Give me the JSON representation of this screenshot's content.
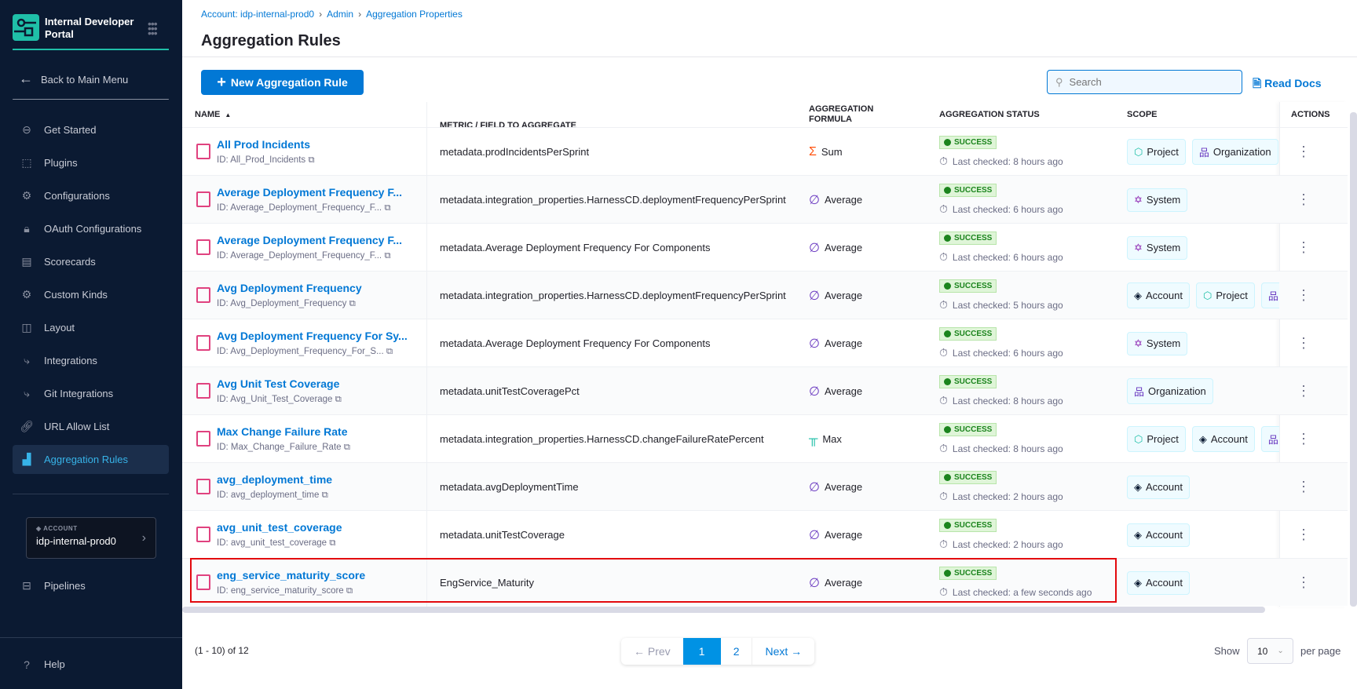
{
  "sidebar": {
    "brand": "Internal Developer Portal",
    "back": "Back to Main Menu",
    "items": [
      {
        "label": "Get Started",
        "icon": "get-started-icon"
      },
      {
        "label": "Plugins",
        "icon": "plugins-icon"
      },
      {
        "label": "Configurations",
        "icon": "gears-icon"
      },
      {
        "label": "OAuth Configurations",
        "icon": "lock-icon"
      },
      {
        "label": "Scorecards",
        "icon": "scorecard-icon"
      },
      {
        "label": "Custom Kinds",
        "icon": "gear-icon"
      },
      {
        "label": "Layout",
        "icon": "layout-icon"
      },
      {
        "label": "Integrations",
        "icon": "integrations-icon"
      },
      {
        "label": "Git Integrations",
        "icon": "git-icon"
      },
      {
        "label": "URL Allow List",
        "icon": "link-icon"
      },
      {
        "label": "Aggregation Rules",
        "icon": "aggregation-icon",
        "active": true
      }
    ],
    "account": {
      "label": "ACCOUNT",
      "value": "idp-internal-prod0"
    },
    "pipelines": "Pipelines",
    "help": "Help"
  },
  "breadcrumb": [
    "Account: idp-internal-prod0",
    "Admin",
    "Aggregation Properties"
  ],
  "page_title": "Aggregation Rules",
  "toolbar": {
    "new_label": "New Aggregation Rule",
    "search_placeholder": "Search",
    "docs_label": "Read Docs"
  },
  "table": {
    "headers": {
      "name": "NAME",
      "metric": "METRIC / FIELD TO AGGREGATE",
      "formula": "AGGREGATION FORMULA",
      "status": "AGGREGATION STATUS",
      "scope": "SCOPE",
      "actions": "ACTIONS"
    },
    "rows": [
      {
        "name": "All Prod Incidents",
        "id": "ID: All_Prod_Incidents",
        "metric": "metadata.prodIncidentsPerSprint",
        "formula": "Sum",
        "status": "SUCCESS",
        "checked": "Last checked: 8 hours ago",
        "scopes": [
          "Project",
          "Organization"
        ]
      },
      {
        "name": "Average Deployment Frequency F...",
        "id": "ID: Average_Deployment_Frequency_F...",
        "metric": "metadata.integration_properties.HarnessCD.deploymentFrequencyPerSprint",
        "formula": "Average",
        "status": "SUCCESS",
        "checked": "Last checked: 6 hours ago",
        "scopes": [
          "System"
        ]
      },
      {
        "name": "Average Deployment Frequency F...",
        "id": "ID: Average_Deployment_Frequency_F...",
        "metric": "metadata.Average Deployment Frequency For Components",
        "formula": "Average",
        "status": "SUCCESS",
        "checked": "Last checked: 6 hours ago",
        "scopes": [
          "System"
        ]
      },
      {
        "name": "Avg Deployment Frequency",
        "id": "ID: Avg_Deployment_Frequency",
        "metric": "metadata.integration_properties.HarnessCD.deploymentFrequencyPerSprint",
        "formula": "Average",
        "status": "SUCCESS",
        "checked": "Last checked: 5 hours ago",
        "scopes": [
          "Account",
          "Project",
          "Organization"
        ]
      },
      {
        "name": "Avg Deployment Frequency For Sy...",
        "id": "ID: Avg_Deployment_Frequency_For_S...",
        "metric": "metadata.Average Deployment Frequency For Components",
        "formula": "Average",
        "status": "SUCCESS",
        "checked": "Last checked: 6 hours ago",
        "scopes": [
          "System"
        ]
      },
      {
        "name": "Avg Unit Test Coverage",
        "id": "ID: Avg_Unit_Test_Coverage",
        "metric": "metadata.unitTestCoveragePct",
        "formula": "Average",
        "status": "SUCCESS",
        "checked": "Last checked: 8 hours ago",
        "scopes": [
          "Organization"
        ]
      },
      {
        "name": "Max Change Failure Rate",
        "id": "ID: Max_Change_Failure_Rate",
        "metric": "metadata.integration_properties.HarnessCD.changeFailureRatePercent",
        "formula": "Max",
        "status": "SUCCESS",
        "checked": "Last checked: 8 hours ago",
        "scopes": [
          "Project",
          "Account",
          "Organization"
        ]
      },
      {
        "name": "avg_deployment_time",
        "id": "ID: avg_deployment_time",
        "metric": "metadata.avgDeploymentTime",
        "formula": "Average",
        "status": "SUCCESS",
        "checked": "Last checked: 2 hours ago",
        "scopes": [
          "Account"
        ]
      },
      {
        "name": "avg_unit_test_coverage",
        "id": "ID: avg_unit_test_coverage",
        "metric": "metadata.unitTestCoverage",
        "formula": "Average",
        "status": "SUCCESS",
        "checked": "Last checked: 2 hours ago",
        "scopes": [
          "Account"
        ]
      },
      {
        "name": "eng_service_maturity_score",
        "id": "ID: eng_service_maturity_score",
        "metric": "EngService_Maturity",
        "formula": "Average",
        "status": "SUCCESS",
        "checked": "Last checked: a few seconds ago",
        "scopes": [
          "Account"
        ],
        "highlighted": true
      }
    ]
  },
  "pagination": {
    "count": "(1 - 10) of 12",
    "prev": "← Prev",
    "pages": [
      "1",
      "2"
    ],
    "current": "1",
    "next": "Next →",
    "show": "Show",
    "per_page_value": "10",
    "per_page": "per page"
  },
  "colors": {
    "sidebar_bg": "#0b1a32",
    "accent": "#0278d5",
    "teal": "#1fbfa8",
    "success": "#1b841d",
    "highlight": "#e3090e"
  }
}
